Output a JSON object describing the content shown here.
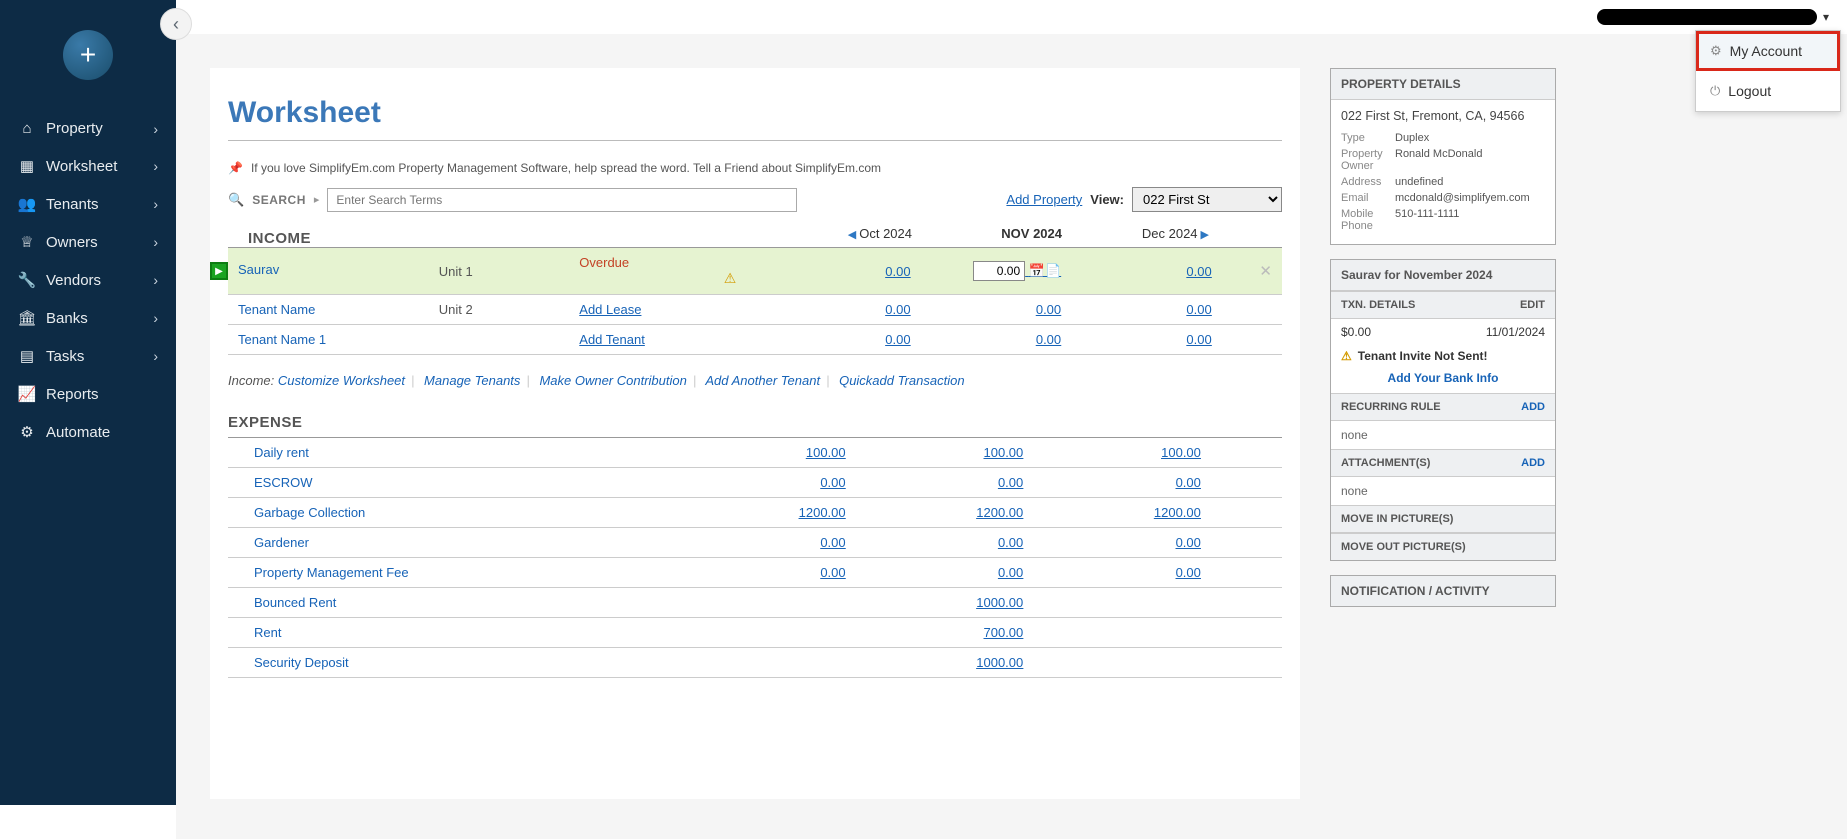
{
  "sidebar": {
    "items": [
      {
        "label": "Property",
        "icon": "home"
      },
      {
        "label": "Worksheet",
        "icon": "grid"
      },
      {
        "label": "Tenants",
        "icon": "people"
      },
      {
        "label": "Owners",
        "icon": "crown"
      },
      {
        "label": "Vendors",
        "icon": "wrench"
      },
      {
        "label": "Banks",
        "icon": "bank"
      },
      {
        "label": "Tasks",
        "icon": "card"
      },
      {
        "label": "Reports",
        "icon": "chart"
      },
      {
        "label": "Automate",
        "icon": "sliders"
      }
    ]
  },
  "user_menu": {
    "my_account": "My Account",
    "logout": "Logout"
  },
  "page": {
    "title": "Worksheet",
    "tell_friend": "If you love SimplifyEm.com Property Management Software, help spread the word. Tell a Friend about SimplifyEm.com",
    "search_label": "SEARCH",
    "search_placeholder": "Enter Search Terms",
    "add_property": "Add Property",
    "view_label": "View:",
    "view_value": "022 First St"
  },
  "months": {
    "prev": "Oct 2024",
    "current": "NOV 2024",
    "next": "Dec 2024"
  },
  "income": {
    "title": "INCOME",
    "rows": [
      {
        "name": "Saurav",
        "unit": "Unit 1",
        "status": "Overdue",
        "status_type": "overdue",
        "oct": "0.00",
        "nov": "0.00",
        "dec": "0.00",
        "nov_input": "0.00",
        "highlight": true,
        "warn": true,
        "close": true
      },
      {
        "name": "Tenant Name",
        "unit": "Unit 2",
        "status": "Add Lease",
        "status_type": "link",
        "oct": "0.00",
        "nov": "0.00",
        "dec": "0.00"
      },
      {
        "name": "Tenant Name 1",
        "unit": "",
        "status": "Add Tenant",
        "status_type": "link",
        "oct": "0.00",
        "nov": "0.00",
        "dec": "0.00"
      }
    ],
    "links_prefix": "Income:",
    "links": [
      "Customize Worksheet",
      "Manage Tenants",
      "Make Owner Contribution",
      "Add Another Tenant",
      "Quickadd Transaction"
    ]
  },
  "expense": {
    "title": "EXPENSE",
    "rows": [
      {
        "name": "Daily rent",
        "oct": "100.00",
        "nov": "100.00",
        "dec": "100.00"
      },
      {
        "name": "ESCROW",
        "oct": "0.00",
        "nov": "0.00",
        "dec": "0.00"
      },
      {
        "name": "Garbage Collection",
        "oct": "1200.00",
        "nov": "1200.00",
        "dec": "1200.00"
      },
      {
        "name": "Gardener",
        "oct": "0.00",
        "nov": "0.00",
        "dec": "0.00"
      },
      {
        "name": "Property Management Fee",
        "oct": "0.00",
        "nov": "0.00",
        "dec": "0.00"
      },
      {
        "name": "Bounced Rent",
        "oct": "",
        "nov": "1000.00",
        "dec": ""
      },
      {
        "name": "Rent",
        "oct": "",
        "nov": "700.00",
        "dec": ""
      },
      {
        "name": "Security Deposit",
        "oct": "",
        "nov": "1000.00",
        "dec": ""
      }
    ]
  },
  "property_details": {
    "title": "PROPERTY DETAILS",
    "address": "022 First St, Fremont, CA, 94566",
    "type_label": "Type",
    "type": "Duplex",
    "owner_label": "Property Owner",
    "owner": "Ronald McDonald",
    "address_label": "Address",
    "address_val": "undefined",
    "email_label": "Email",
    "email": "mcdonald@simplifyem.com",
    "phone_label": "Mobile Phone",
    "phone": "510-111-1111"
  },
  "tenant_panel": {
    "title": "Saurav for November 2024",
    "txn_title": "TXN. DETAILS",
    "edit": "EDIT",
    "amount": "$0.00",
    "date": "11/01/2024",
    "invite_warning": "Tenant Invite Not Sent!",
    "bank_link": "Add Your Bank Info",
    "recurring_title": "RECURRING RULE",
    "add": "ADD",
    "none": "none",
    "attachments_title": "ATTACHMENT(S)",
    "movein_title": "MOVE IN PICTURE(S)",
    "moveout_title": "MOVE OUT PICTURE(S)",
    "notification_title": "NOTIFICATION / ACTIVITY"
  }
}
